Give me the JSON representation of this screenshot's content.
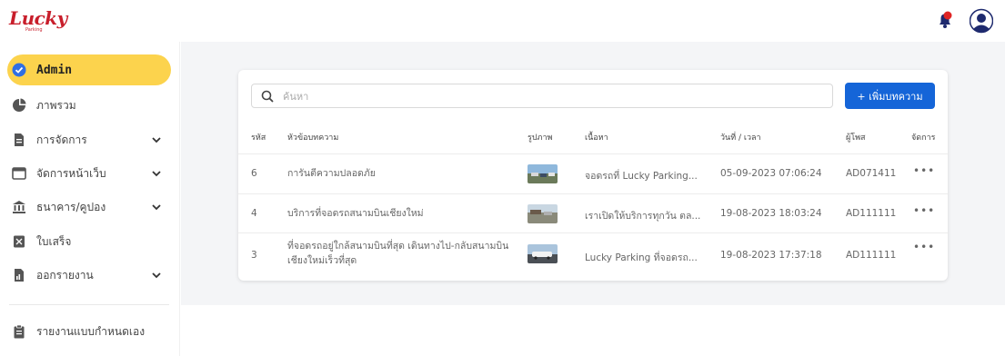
{
  "brand": {
    "name": "Lucky",
    "sub": "Parking"
  },
  "colors": {
    "accent": "#1565d8",
    "active": "#fcd34d",
    "brand": "#c81e2b"
  },
  "sidebar": {
    "items": [
      {
        "label": "Admin",
        "icon": "verified-badge-icon"
      },
      {
        "label": "ภาพรวม",
        "icon": "pie-chart-icon"
      },
      {
        "label": "การจัดการ",
        "icon": "document-icon"
      },
      {
        "label": "จัดการหน้าเว็บ",
        "icon": "browser-window-icon"
      },
      {
        "label": "ธนาคาร/คูปอง",
        "icon": "bank-icon"
      },
      {
        "label": "ใบเสร็จ",
        "icon": "receipt-icon"
      },
      {
        "label": "ออกรายงาน",
        "icon": "report-file-icon"
      },
      {
        "label": "รายงานแบบกำหนดเอง",
        "icon": "clipboard-icon"
      }
    ]
  },
  "search": {
    "placeholder": "ค้นหา"
  },
  "add_button": {
    "label": "+ เพิ่มบทความ"
  },
  "table": {
    "headers": [
      "รหัส",
      "หัวข้อบทความ",
      "รูปภาพ",
      "เนื้อหา",
      "วันที่ / เวลา",
      "ผู้โพส",
      "จัดการ"
    ],
    "rows": [
      {
        "id": "6",
        "title": "การันตีความปลอดภัย",
        "content": "จอดรถที่ Lucky Parking...",
        "datetime": "05-09-2023 07:06:24",
        "author": "AD071411",
        "action": "•••"
      },
      {
        "id": "4",
        "title": "บริการที่จอดรถสนามบินเชียงใหม่",
        "content": "เราเปิดให้บริการทุกวัน ตล...",
        "datetime": "19-08-2023 18:03:24",
        "author": "AD111111",
        "action": "•••"
      },
      {
        "id": "3",
        "title": "ที่จอดรถอยู่ใกล้สนามบินที่สุด เดินทางไป-กลับสนามบินเชียงใหม่เร็วที่สุด",
        "content": "Lucky Parking ที่จอดรถ...",
        "datetime": "19-08-2023 17:37:18",
        "author": "AD111111",
        "action": "•••"
      }
    ]
  }
}
